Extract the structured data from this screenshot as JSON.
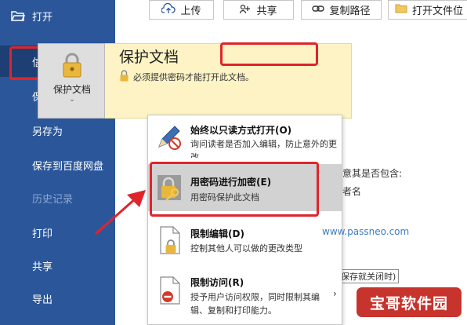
{
  "sidebar": {
    "open_label": "打开",
    "items": [
      {
        "label": "信息",
        "selected": true
      },
      {
        "label": "保存"
      },
      {
        "label": "另存为"
      },
      {
        "label": "保存到百度网盘"
      },
      {
        "label": "历史记录",
        "disabled": true
      },
      {
        "label": "打印"
      },
      {
        "label": "共享"
      },
      {
        "label": "导出"
      }
    ]
  },
  "toolbar": {
    "upload_label": "上传",
    "share_label": "共享",
    "copy_path_label": "复制路径",
    "open_location_label": "打开文件位"
  },
  "protect": {
    "button_label": "保护文档",
    "caret": "⌄",
    "title": "保护文档",
    "description": "必须提供密码才能打开此文档。"
  },
  "behind": {
    "check_text": "意其是否包含:",
    "author_text": "者名",
    "close_text": "保存就关闭时)"
  },
  "menu": {
    "items": [
      {
        "title": "始终以只读方式打开(O)",
        "description": "询问读者是否加入编辑，防止意外的更改。"
      },
      {
        "title": "用密码进行加密(E)",
        "description": "用密码保护此文档"
      },
      {
        "title": "限制编辑(D)",
        "description": "控制其他人可以做的更改类型"
      },
      {
        "title": "限制访问(R)",
        "description": "授予用户访问权限，同时限制其编辑、复制和打印能力。"
      }
    ],
    "submenu_arrow": "›"
  },
  "watermark": "www.passneo.com",
  "logo_text": "宝哥软件园",
  "colors": {
    "sidebar_bg": "#2b579a",
    "sidebar_selected": "#1d3f74",
    "highlight_red": "#e0242b",
    "banner_bg": "#fdf3c4",
    "logo_bg": "#c7342d"
  }
}
